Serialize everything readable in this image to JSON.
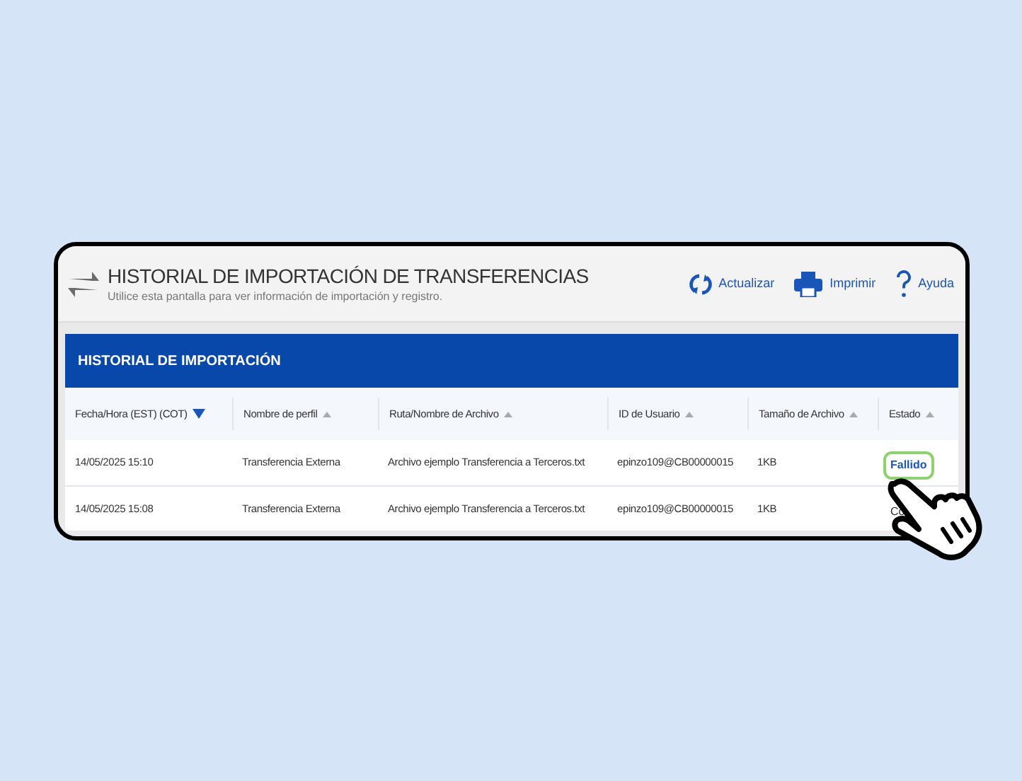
{
  "header": {
    "title": "HISTORIAL DE IMPORTACIÓN DE TRANSFERENCIAS",
    "subtitle": "Utilice esta pantalla para ver información de importación y registro.",
    "actions": [
      {
        "kind": "refresh",
        "label": "Actualizar"
      },
      {
        "kind": "print",
        "label": "Imprimir"
      },
      {
        "kind": "help",
        "label": "Ayuda"
      }
    ]
  },
  "panel": {
    "title": "HISTORIAL DE IMPORTACIÓN"
  },
  "table": {
    "columns": [
      {
        "label": "Fecha/Hora (EST) (COT)",
        "selected": true
      },
      {
        "label": "Nombre de perfil",
        "selected": false
      },
      {
        "label": "Ruta/Nombre de Archivo",
        "selected": false
      },
      {
        "label": "ID de Usuario",
        "selected": false
      },
      {
        "label": "Tamaño de Archivo",
        "selected": false
      },
      {
        "label": "Estado",
        "selected": false
      }
    ],
    "rows": [
      {
        "cells": [
          "14/05/2025 15:10",
          "Transferencia Externa",
          "Archivo ejemplo Transferencia a Terceros.txt",
          "epinzo109@CB00000015",
          "1KB"
        ],
        "status": "Fallido",
        "highlighted": true
      },
      {
        "cells": [
          "14/05/2025 15:08",
          "Transferencia Externa",
          "Archivo ejemplo Transferencia a Terceros.txt",
          "epinzo109@CB00000015",
          "1KB"
        ],
        "status": "Co",
        "highlighted": false
      }
    ]
  }
}
